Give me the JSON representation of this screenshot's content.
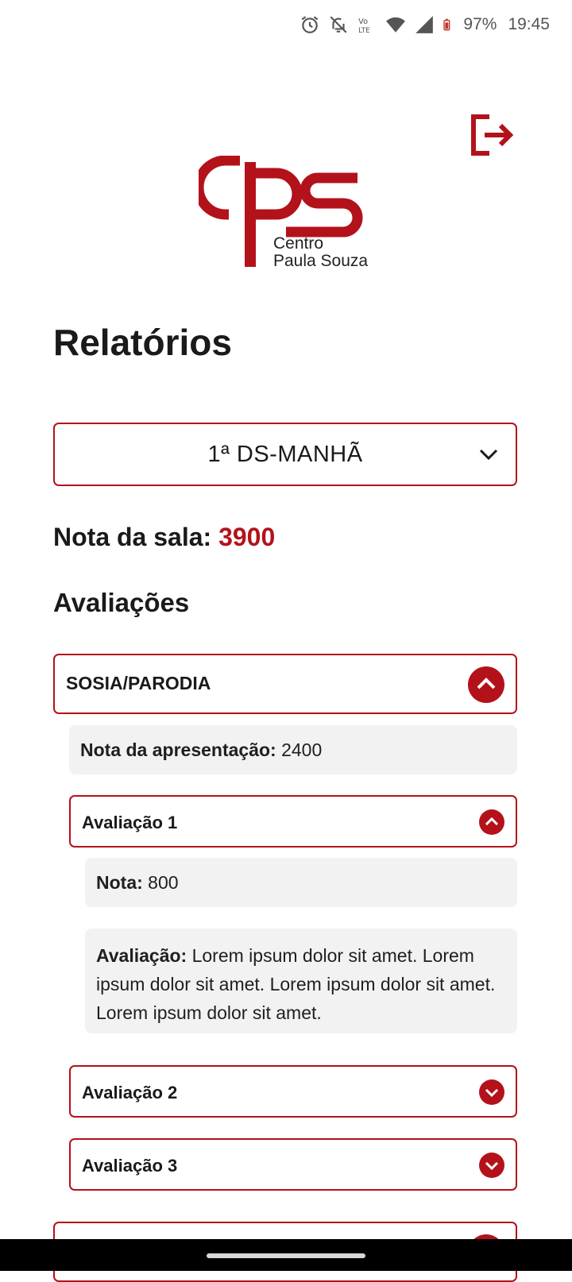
{
  "status_bar": {
    "battery": "97%",
    "time": "19:45",
    "icons": [
      "alarm-icon",
      "bell-off-icon",
      "volte-icon",
      "wifi-icon",
      "signal-icon",
      "battery-icon"
    ]
  },
  "logo": {
    "brand": "cps",
    "line1": "Centro",
    "line2": "Paula Souza",
    "color": "#b3121b"
  },
  "page": {
    "title": "Relatórios"
  },
  "class_select": {
    "value": "1ª DS-MANHÃ"
  },
  "room_score": {
    "label": "Nota da sala:",
    "value": "3900"
  },
  "evaluations": {
    "title": "Avaliações",
    "groups": [
      {
        "name": "SOSIA/PARODIA",
        "presentation_label": "Nota da apresentação:",
        "presentation_value": "2400",
        "items": [
          {
            "name": "Avaliação 1",
            "expanded": true,
            "score_label": "Nota:",
            "score_value": "800",
            "comment_label": "Avaliação:",
            "comment": "Lorem ipsum dolor sit amet. Lorem ipsum dolor sit amet. Lorem ipsum dolor sit amet. Lorem ipsum dolor sit amet."
          },
          {
            "name": "Avaliação 2",
            "expanded": false
          },
          {
            "name": "Avaliação 3",
            "expanded": false
          }
        ]
      }
    ]
  },
  "colors": {
    "accent": "#b3121b",
    "panel": "#f2f2f2"
  }
}
